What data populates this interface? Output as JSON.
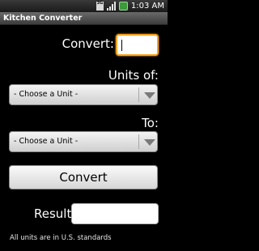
{
  "status_bar": {
    "network": "3G",
    "time": "1:03 AM"
  },
  "app": {
    "title": "Kitchen Converter"
  },
  "form": {
    "convert_label": "Convert:",
    "convert_value": "",
    "units_of_label": "Units of:",
    "from_unit_selected": "- Choose a Unit -",
    "to_label": "To:",
    "to_unit_selected": "- Choose a Unit -",
    "convert_button_label": "Convert",
    "result_label": "Result:",
    "result_value": ""
  },
  "footer": {
    "note": "All units are in U.S. standards"
  },
  "colors": {
    "focus_accent": "#f6a11b",
    "background": "#000000",
    "battery": "#3b9a3b"
  }
}
